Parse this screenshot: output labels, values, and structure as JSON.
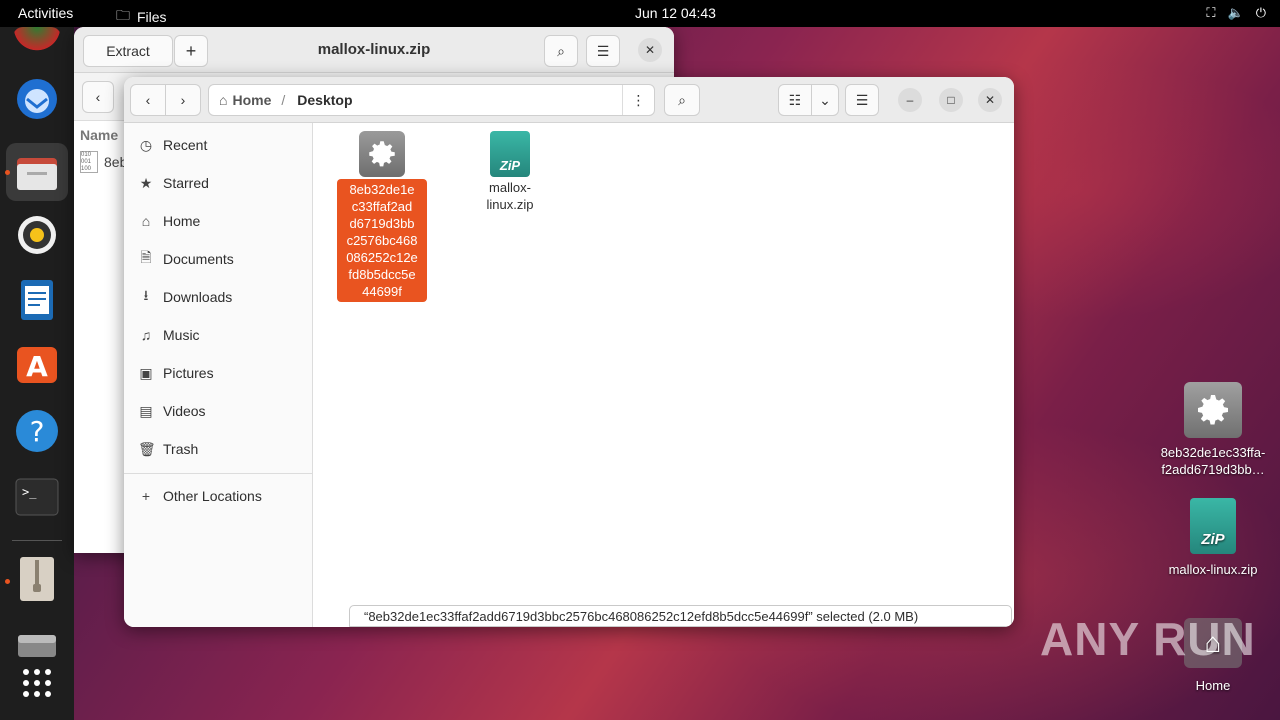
{
  "topbar": {
    "activities": "Activities",
    "app_name": "Files",
    "clock": "Jun 12  04:43"
  },
  "archive_window": {
    "title": "mallox-linux.zip",
    "extract_label": "Extract",
    "column_name": "Name",
    "row_item": "8eb"
  },
  "files_window": {
    "path_home": "Home",
    "path_current": "Desktop",
    "sidebar": [
      {
        "label": "Recent",
        "icon": "clock-icon"
      },
      {
        "label": "Starred",
        "icon": "star-icon"
      },
      {
        "label": "Home",
        "icon": "home-icon"
      },
      {
        "label": "Documents",
        "icon": "document-icon"
      },
      {
        "label": "Downloads",
        "icon": "download-icon"
      },
      {
        "label": "Music",
        "icon": "music-icon"
      },
      {
        "label": "Pictures",
        "icon": "picture-icon"
      },
      {
        "label": "Videos",
        "icon": "video-icon"
      },
      {
        "label": "Trash",
        "icon": "trash-icon"
      }
    ],
    "other_locations": "Other Locations",
    "files": [
      {
        "name": "8eb32de1e\nc33ffaf2ad\nd6719d3bb\nc2576bc468\n086252c12e\nfd8b5dcc5e\n44699f",
        "selected": true,
        "icon": "gear-icon"
      },
      {
        "name": "mallox-\nlinux.zip",
        "selected": false,
        "icon": "zip-icon"
      }
    ],
    "status": "“8eb32de1ec33ffaf2add6719d3bbc2576bc468086252c12efd8b5dcc5e44699f” selected  (2.0 MB)"
  },
  "desktop": {
    "items": [
      {
        "label": "8eb32de1ec33ffa-\nf2add6719d3bb…"
      },
      {
        "label": "mallox-linux.zip"
      },
      {
        "label": "Home"
      }
    ]
  },
  "watermark": "ANY RUN"
}
